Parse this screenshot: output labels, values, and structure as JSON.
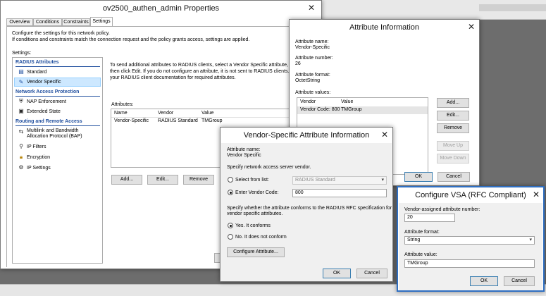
{
  "desktop": {
    "top_strip": "",
    "colors": {
      "background": "#6d6d6d",
      "accent": "#1f4e9e",
      "selection": "#cde8ff"
    }
  },
  "properties": {
    "title": "ov2500_authen_admin Properties",
    "tabs": [
      "Overview",
      "Conditions",
      "Constraints",
      "Settings"
    ],
    "active_tab": "Settings",
    "intro_line1": "Configure the settings for this network policy.",
    "intro_line2": "If conditions and constraints match the connection request and the policy grants access, settings are applied.",
    "settings_label": "Settings:",
    "nav": {
      "radius_header": "RADIUS Attributes",
      "standard": "Standard",
      "vendor_specific": "Vendor Specific",
      "nap_header": "Network Access Protection",
      "nap_enforcement": "NAP Enforcement",
      "extended_state": "Extended State",
      "rra_header": "Routing and Remote Access",
      "multilink_1": "Multilink and Bandwidth",
      "multilink_2": "Allocation Protocol (BAP)",
      "ip_filters": "IP Filters",
      "encryption": "Encryption",
      "ip_settings": "IP Settings"
    },
    "desc_line1": "To send additional attributes to RADIUS clients, select a Vendor Specific attribute, and",
    "desc_line2": "then click Edit. If you do not configure an attribute, it is not sent to RADIUS clients. Se",
    "desc_line3": "your RADIUS client documentation for required attributes.",
    "attributes_label": "Attributes:",
    "table": {
      "headers": [
        "Name",
        "Vendor",
        "Value"
      ],
      "rows": [
        {
          "name": "Vendor-Specific",
          "vendor": "RADIUS Standard",
          "value": "TMGroup"
        }
      ]
    },
    "buttons": {
      "add": "Add...",
      "edit": "Edit...",
      "remove": "Remove"
    }
  },
  "attr_info": {
    "title": "Attribute Information",
    "name_label": "Attribute name:",
    "name_value": "Vendor-Specific",
    "number_label": "Attribute number:",
    "number_value": "26",
    "format_label": "Attribute format:",
    "format_value": "OctetString",
    "values_label": "Attribute values:",
    "table_headers": [
      "Vendor",
      "Value"
    ],
    "table_row": {
      "vendor": "Vendor Code: 800",
      "value": "TMGroup"
    },
    "buttons": {
      "add": "Add...",
      "edit": "Edit...",
      "remove": "Remove",
      "move_up": "Move Up",
      "move_down": "Move Down",
      "ok": "OK",
      "cancel": "Cancel"
    }
  },
  "vsa_info": {
    "title": "Vendor-Specific Attribute Information",
    "name_label": "Attribute name:",
    "name_value": "Vendor Specific",
    "specify_label": "Specify network access server vendor.",
    "select_from_list": "Select from list:",
    "select_value": "RADIUS Standard",
    "enter_vendor_code": "Enter Vendor Code:",
    "vendor_code": "800",
    "conform_line1": "Specify whether the attribute conforms to the RADIUS RFC specification for",
    "conform_line2": "vendor specific attributes.",
    "yes_conforms": "Yes. It conforms",
    "no_conforms": "No. It does not conform",
    "configure_button": "Configure Attribute...",
    "ok": "OK",
    "cancel": "Cancel"
  },
  "configure_vsa": {
    "title": "Configure VSA (RFC Compliant)",
    "number_label": "Vendor-assigned attribute number:",
    "number_value": "20",
    "format_label": "Attribute format:",
    "format_value": "String",
    "value_label": "Attribute value:",
    "value_value": "TMGroup",
    "ok": "OK",
    "cancel": "Cancel"
  }
}
